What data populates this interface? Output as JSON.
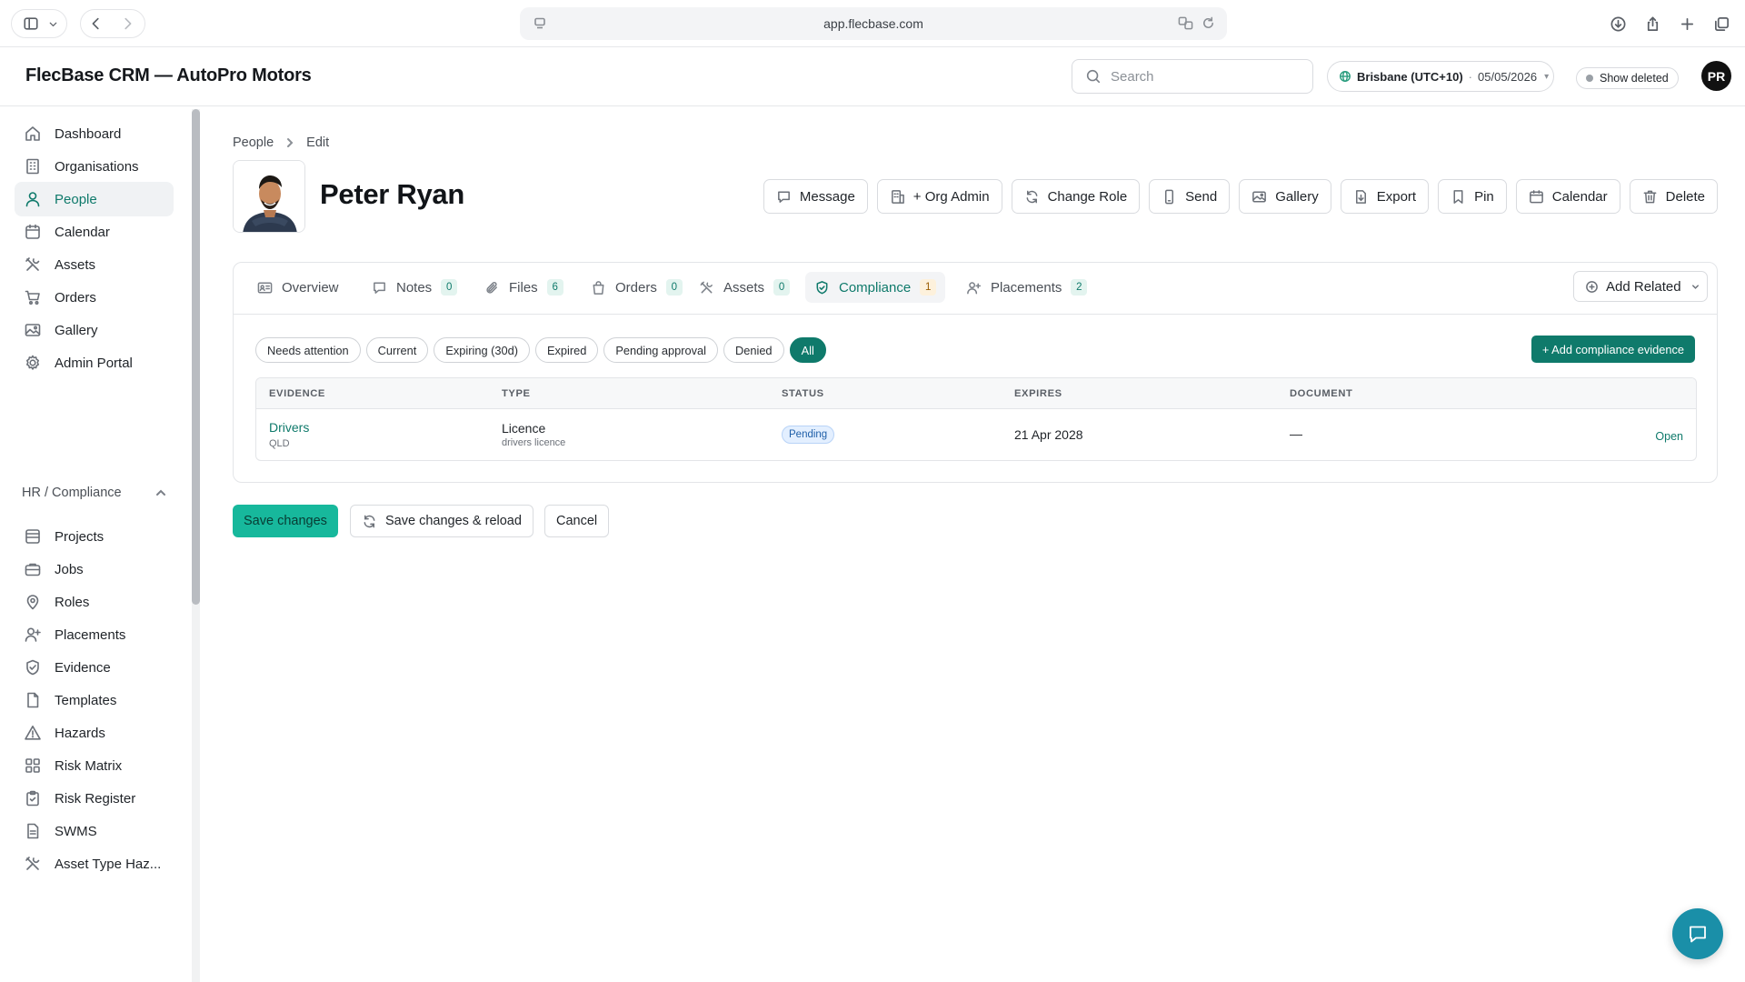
{
  "browser": {
    "url": "app.flecbase.com"
  },
  "header": {
    "title": "FlecBase CRM — AutoPro Motors",
    "search_placeholder": "Search",
    "timezone_city": "Brisbane (UTC+10)",
    "timezone_sep": "·",
    "timezone_date": "05/05/2026",
    "show_deleted_label": "Show deleted",
    "avatar_initials": "PR"
  },
  "sidebar": {
    "items": [
      {
        "label": "Dashboard",
        "icon": "home-icon"
      },
      {
        "label": "Organisations",
        "icon": "building-icon"
      },
      {
        "label": "People",
        "icon": "user-icon",
        "active": true
      },
      {
        "label": "Calendar",
        "icon": "calendar-icon"
      },
      {
        "label": "Assets",
        "icon": "tools-icon"
      },
      {
        "label": "Orders",
        "icon": "cart-icon"
      },
      {
        "label": "Gallery",
        "icon": "image-icon"
      },
      {
        "label": "Admin Portal",
        "icon": "gear-icon"
      }
    ],
    "section_label": "HR / Compliance",
    "section_items": [
      {
        "label": "Projects",
        "icon": "folder-icon"
      },
      {
        "label": "Jobs",
        "icon": "briefcase-icon"
      },
      {
        "label": "Roles",
        "icon": "pin-icon"
      },
      {
        "label": "Placements",
        "icon": "user-plus-icon"
      },
      {
        "label": "Evidence",
        "icon": "shield-check-icon"
      },
      {
        "label": "Templates",
        "icon": "document-icon"
      },
      {
        "label": "Hazards",
        "icon": "warning-icon"
      },
      {
        "label": "Risk Matrix",
        "icon": "grid-icon"
      },
      {
        "label": "Risk Register",
        "icon": "clipboard-icon"
      },
      {
        "label": "SWMS",
        "icon": "file-text-icon"
      },
      {
        "label": "Asset Type Haz...",
        "icon": "tools-icon"
      }
    ]
  },
  "breadcrumb": {
    "parent": "People",
    "current": "Edit"
  },
  "person": {
    "name": "Peter Ryan"
  },
  "actions": [
    {
      "label": "Message",
      "icon": "chat-icon"
    },
    {
      "label": "+ Org Admin",
      "icon": "building-icon"
    },
    {
      "label": "Change Role",
      "icon": "refresh-icon"
    },
    {
      "label": "Send",
      "icon": "phone-icon"
    },
    {
      "label": "Gallery",
      "icon": "image-icon"
    },
    {
      "label": "Export",
      "icon": "file-export-icon"
    },
    {
      "label": "Pin",
      "icon": "bookmark-icon"
    },
    {
      "label": "Calendar",
      "icon": "calendar-icon"
    },
    {
      "label": "Delete",
      "icon": "trash-icon"
    }
  ],
  "tabs": [
    {
      "label": "Overview",
      "icon": "id-card-icon"
    },
    {
      "label": "Notes",
      "icon": "chat-icon",
      "count": "0"
    },
    {
      "label": "Files",
      "icon": "paperclip-icon",
      "count": "6"
    },
    {
      "label": "Orders",
      "icon": "bag-icon",
      "count": "0"
    },
    {
      "label": "Assets",
      "icon": "tools-icon",
      "count": "0"
    },
    {
      "label": "Compliance",
      "icon": "shield-check-icon",
      "count": "1",
      "active": true
    },
    {
      "label": "Placements",
      "icon": "user-plus-icon",
      "count": "2"
    }
  ],
  "add_related_label": "Add Related",
  "filters": [
    "Needs attention",
    "Current",
    "Expiring (30d)",
    "Expired",
    "Pending approval",
    "Denied",
    "All"
  ],
  "active_filter": "All",
  "add_evidence_label": "+ Add compliance evidence",
  "table": {
    "headers": [
      "EVIDENCE",
      "TYPE",
      "STATUS",
      "EXPIRES",
      "DOCUMENT"
    ],
    "rows": [
      {
        "evidence": "Drivers",
        "evidence_sub": "QLD",
        "type": "Licence",
        "type_sub": "drivers licence",
        "status": "Pending",
        "expires": "21 Apr 2028",
        "document": "—",
        "action": "Open"
      }
    ]
  },
  "footer_buttons": {
    "save": "Save changes",
    "save_reload": "Save changes & reload",
    "cancel": "Cancel"
  },
  "colors": {
    "accent": "#0f7a6b",
    "save_button": "#17b89c",
    "chat_fab": "#1a8fa8",
    "pending_badge": "#e3efff"
  }
}
